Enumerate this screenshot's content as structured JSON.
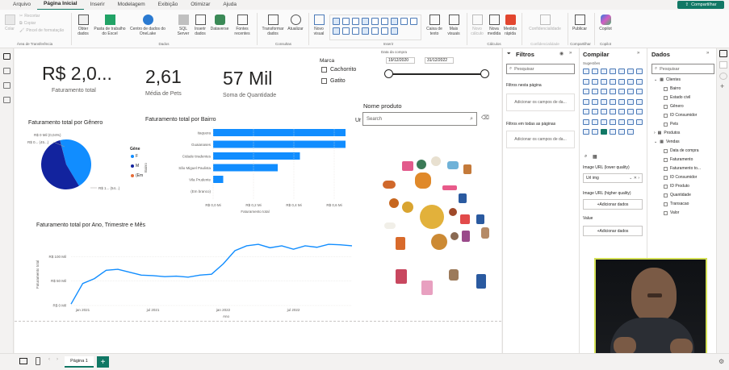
{
  "menu": {
    "items": [
      "Arquivo",
      "Página Inicial",
      "Inserir",
      "Modelagem",
      "Exibição",
      "Otimizar",
      "Ajuda"
    ],
    "share": "Compartilhar"
  },
  "ribbon": {
    "clipboard": {
      "paste": "Colar",
      "cut": "Recortar",
      "copy": "Copiar",
      "format": "Pincel de formatação",
      "group": "Área de Transferência"
    },
    "data": {
      "get": "Obter dados",
      "excel": "Pasta de trabalho do Excel",
      "onelake": "Centro de dados do OneLake",
      "sql": "SQL Server",
      "enter": "Inserir dados",
      "dataverse": "Dataverse",
      "recent": "Fontes recentes",
      "group": "Dados"
    },
    "queries": {
      "transform": "Transformar dados",
      "refresh": "Atualizar",
      "group": "Consultas"
    },
    "insert": {
      "new_visual": "Novo visual",
      "textbox": "Caixa de texto",
      "more": "Mais visuais",
      "group": "Inserir"
    },
    "calc": {
      "new_calc": "Novo cálculo",
      "new_measure": "Nova medida",
      "quick": "Medida rápida",
      "group": "Cálculos"
    },
    "sensitivity": {
      "label": "Confidencialidade",
      "group": "Confidencialidade"
    },
    "share": {
      "publish": "Publicar",
      "group": "Compartilhar"
    },
    "copilot": {
      "label": "Copilot",
      "group": "Copilot"
    }
  },
  "report": {
    "kpis": [
      {
        "value": "R$ 2,0...",
        "label": "Faturamento total"
      },
      {
        "value": "2,61",
        "label": "Média de Pets"
      },
      {
        "value": "57 Mil",
        "label": "Soma de Quantidade"
      }
    ],
    "slicer_marca": {
      "title": "Marca",
      "options": [
        "Cachorrito",
        "Gatito"
      ]
    },
    "slicer_data": {
      "title": "Data da compra",
      "start": "19/12/2020",
      "end": "31/12/2022"
    },
    "slicer_produto": {
      "title": "Nome produto",
      "placeholder": "Search",
      "prefix": "Ur"
    },
    "pie": {
      "title": "Faturamento total por Gênero",
      "legend_title": "Gêne",
      "legend": [
        "F",
        "M",
        "(Em"
      ],
      "labels": [
        "R$ 0 Mil (0,04%)",
        "R$ 0... (45...)",
        "R$ 1... (54...)"
      ]
    },
    "bar": {
      "title": "Faturamento total por Bairro",
      "axis_title_y": "Bairro",
      "axis_title_x": "Faturamento total"
    },
    "line": {
      "title": "Faturamento total por Ano, Trimestre e Mês",
      "axis_title_y": "Faturamento total",
      "axis_title_x": "Ano"
    }
  },
  "filters": {
    "title": "Filtros",
    "search": "Pesquisar",
    "on_page": "Filtros nesta página",
    "on_all": "Filtros em todas as páginas",
    "add": "Adicionar os campos de da..."
  },
  "build": {
    "title": "Compilar",
    "suggestions": "Sugestões",
    "url_lower": "Image URL (lower quality)",
    "url_value": "Url img",
    "url_higher": "Image URL (higher quality)",
    "add": "+Adicionar dados",
    "value": "Value"
  },
  "data_pane": {
    "title": "Dados",
    "search": "Pesquisar",
    "tables": [
      {
        "name": "Clientes",
        "fields": [
          "Bairro",
          "Estado civil",
          "Gênero",
          "ID Consumidor",
          "Pets"
        ]
      },
      {
        "name": "Produtos",
        "fields": []
      },
      {
        "name": "Vendas",
        "fields": [
          "Data de compra",
          "Faturamento",
          "Faturamento to...",
          "ID Consumidor",
          "ID Produto",
          "Quantidade",
          "Transacao",
          "Valor"
        ]
      }
    ]
  },
  "tabs": {
    "page": "Página 1"
  },
  "colors": {
    "accent": "#117865",
    "series_dark": "#12239e",
    "series_blue": "#118dff",
    "series_orange": "#e66c37"
  },
  "chart_data": [
    {
      "type": "pie",
      "title": "Faturamento total por Gênero",
      "categories": [
        "F",
        "M",
        "(Em branco)"
      ],
      "values": [
        45.4,
        54.56,
        0.04
      ]
    },
    {
      "type": "bar",
      "title": "Faturamento total por Bairro",
      "categories": [
        "Itaquera",
        "Guaianases",
        "Cidade tiradentes",
        "São Miguel Paulista",
        "Vila Prudente",
        "(Em branco)"
      ],
      "values": [
        0.74,
        0.7,
        0.43,
        0.32,
        0.05,
        0
      ],
      "ticks": [
        "R$ 0,0 Mi",
        "R$ 0,2 Mi",
        "R$ 0,4 Mi",
        "R$ 0,6 Mi"
      ],
      "xlim": [
        0,
        0.8
      ],
      "xlabel": "Faturamento total",
      "ylabel": "Bairro"
    },
    {
      "type": "line",
      "title": "Faturamento total por Ano, Trimestre e Mês",
      "x": [
        "2020-12",
        "2021-01",
        "2021-02",
        "2021-03",
        "2021-04",
        "2021-05",
        "2021-06",
        "2021-07",
        "2021-08",
        "2021-09",
        "2021-10",
        "2021-11",
        "2021-12",
        "2022-01",
        "2022-02",
        "2022-03",
        "2022-04",
        "2022-05",
        "2022-06",
        "2022-07",
        "2022-08",
        "2022-09",
        "2022-10",
        "2022-11",
        "2022-12"
      ],
      "values": [
        3,
        45,
        55,
        72,
        74,
        68,
        62,
        61,
        59,
        60,
        58,
        62,
        64,
        85,
        112,
        122,
        125,
        118,
        122,
        115,
        122,
        119,
        125,
        124,
        122
      ],
      "y_ticks": [
        "R$ 0 Mil",
        "R$ 50 Mil",
        "R$ 100 Mil"
      ],
      "x_ticks": [
        "jan 2021",
        "jul 2021",
        "jan 2022",
        "jul 2022"
      ],
      "ylim": [
        0,
        140
      ],
      "xlabel": "Ano",
      "ylabel": "Faturamento total"
    }
  ]
}
